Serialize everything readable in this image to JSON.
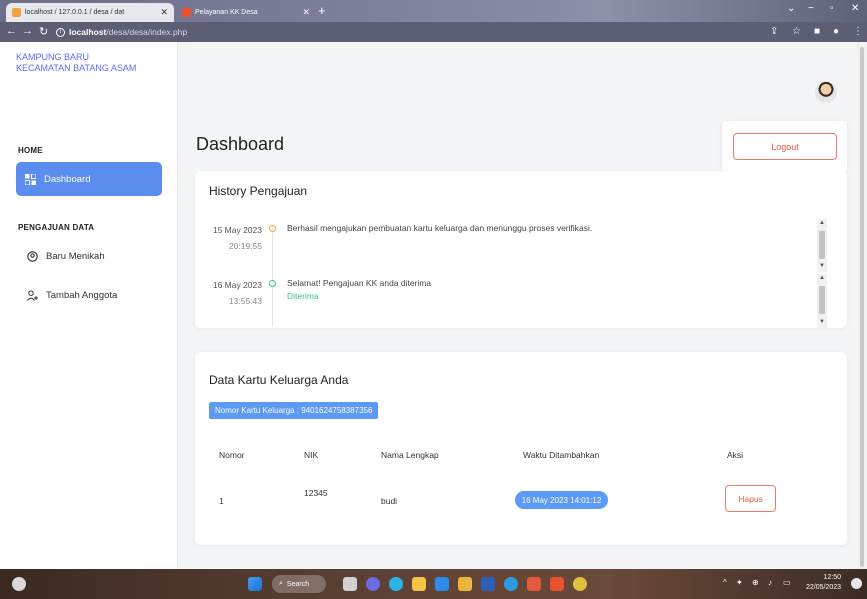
{
  "browser": {
    "tabs": [
      {
        "label": "localhost / 127.0.0.1 / desa / dat",
        "active": true
      },
      {
        "label": "Pelayanan KK Desa",
        "active": false
      }
    ],
    "url_host": "localhost",
    "url_path": "/desa/desa/index.php"
  },
  "sidebar": {
    "brand_line1": "KAMPUNG BARU",
    "brand_line2": "KECAMATAN BATANG ASAM",
    "section_home": "HOME",
    "dashboard_label": "Dashboard",
    "section_pengajuan": "PENGAJUAN DATA",
    "baru_menikah_label": "Baru Menikah",
    "tambah_anggota_label": "Tambah Anggota"
  },
  "main": {
    "title": "Dashboard",
    "logout_label": "Logout"
  },
  "history": {
    "title": "History Pengajuan",
    "items": [
      {
        "date": "15 May 2023",
        "time": "20:19:55",
        "message": "Berhasil mengajukan pembuatan kartu keluarga dan menunggu proses verifikasi.",
        "status": "",
        "dot_color": "#f2a33a"
      },
      {
        "date": "16 May 2023",
        "time": "13:55:43",
        "message": "Selamat! Pengajuan KK anda diterima",
        "status": "Diterima",
        "dot_color": "#3cc38a"
      }
    ]
  },
  "kk": {
    "title": "Data Kartu Keluarga Anda",
    "badge": "Nomor Kartu Keluarga : 9401624758387356",
    "headers": {
      "nomor": "Nomor",
      "nik": "NIK",
      "nama": "Nama Lengkap",
      "waktu": "Waktu Ditambahkan",
      "aksi": "Aksi"
    },
    "rows": [
      {
        "nomor": "1",
        "nik": "12345",
        "nama": "budi",
        "waktu": "16 May 2023 14:01:12",
        "aksi": "Hapus"
      }
    ]
  },
  "taskbar": {
    "search_label": "Search",
    "time": "12:50",
    "date": "22/05/2023"
  }
}
